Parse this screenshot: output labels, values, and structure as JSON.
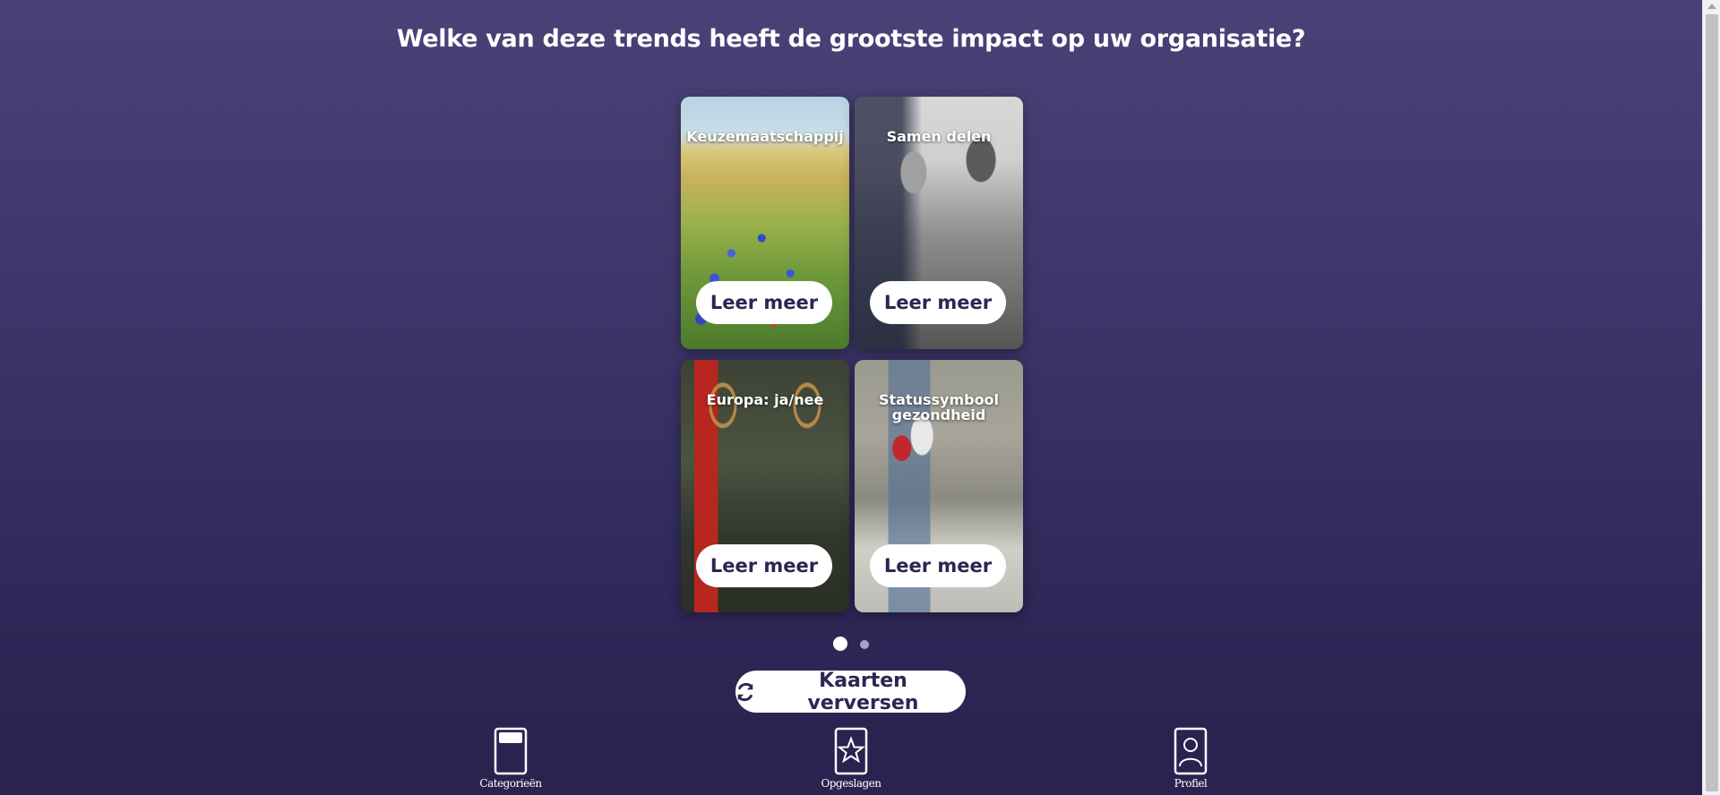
{
  "page": {
    "title": "Welke van deze trends heeft de grootste impact op uw organisatie?"
  },
  "cards": [
    {
      "title": "Keuzemaatschappij",
      "button": "Leer meer"
    },
    {
      "title": "Samen delen",
      "button": "Leer meer"
    },
    {
      "title": "Europa: ja/nee",
      "button": "Leer meer"
    },
    {
      "title": "Statussymbool gezondheid",
      "button": "Leer meer"
    }
  ],
  "pagination": {
    "current": 1,
    "total": 2
  },
  "refresh": {
    "label": "Kaarten verversen",
    "icon": "refresh-icon"
  },
  "nav": [
    {
      "label": "Categorieën",
      "icon": "card-icon"
    },
    {
      "label": "Opgeslagen",
      "icon": "star-card-icon"
    },
    {
      "label": "Profiel",
      "icon": "profile-icon"
    }
  ],
  "colors": {
    "background_top": "#4a4277",
    "background_bottom": "#29224f",
    "nav_background": "#2a2350",
    "button_text": "#2b2652"
  }
}
